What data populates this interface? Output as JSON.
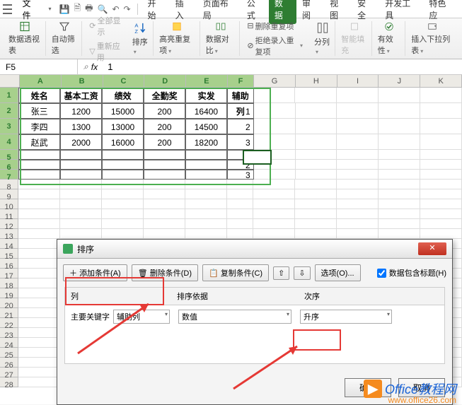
{
  "menu": {
    "file": "文件"
  },
  "tabs": {
    "start": "开始",
    "insert": "插入",
    "pagelayout": "页面布局",
    "formula": "公式",
    "data": "数据",
    "review": "审阅",
    "view": "视图",
    "security": "安全",
    "dev": "开发工具",
    "special": "特色应"
  },
  "ribbon": {
    "pivot": "数据透视表",
    "autofilter": "自动筛选",
    "showall": "全部显示",
    "reapply": "重新应用",
    "sort": "排序",
    "highlightdup": "高亮重复项",
    "datacompare": "数据对比",
    "removedup": "删除重复项",
    "rejectdup": "拒绝录入重复项",
    "splitcol": "分列",
    "smartfill": "智能填充",
    "validation": "有效性",
    "dropdown": "插入下拉列表"
  },
  "cellref": {
    "name": "F5",
    "fx": "fx",
    "value": "1"
  },
  "cols": [
    "A",
    "B",
    "C",
    "D",
    "E",
    "F",
    "G",
    "H",
    "I",
    "J",
    "K"
  ],
  "chart_data": {
    "type": "table",
    "headers": [
      "姓名",
      "基本工资",
      "绩效",
      "全勤奖",
      "实发",
      "辅助列"
    ],
    "rows": [
      [
        "张三",
        "1200",
        "15000",
        "200",
        "16400",
        "1"
      ],
      [
        "李四",
        "1300",
        "13000",
        "200",
        "14500",
        "2"
      ],
      [
        "赵武",
        "2000",
        "16000",
        "200",
        "18200",
        "3"
      ],
      [
        "",
        "",
        "",
        "",
        "",
        "1"
      ],
      [
        "",
        "",
        "",
        "",
        "",
        "2"
      ],
      [
        "",
        "",
        "",
        "",
        "",
        "3"
      ]
    ]
  },
  "dialog": {
    "title": "排序",
    "addcond": "添加条件(A)",
    "delcond": "删除条件(D)",
    "copycond": "复制条件(C)",
    "options": "选项(O)...",
    "headercheck": "数据包含标题(H)",
    "col_col": "列",
    "col_sortby": "排序依据",
    "col_order": "次序",
    "primary": "主要关键字",
    "keyfield": "辅助列",
    "sortby": "数值",
    "order": "升序",
    "ok": "确定",
    "cancel": "取消"
  },
  "watermark": {
    "brand": "Office教程网",
    "url": "www.office26.com"
  }
}
